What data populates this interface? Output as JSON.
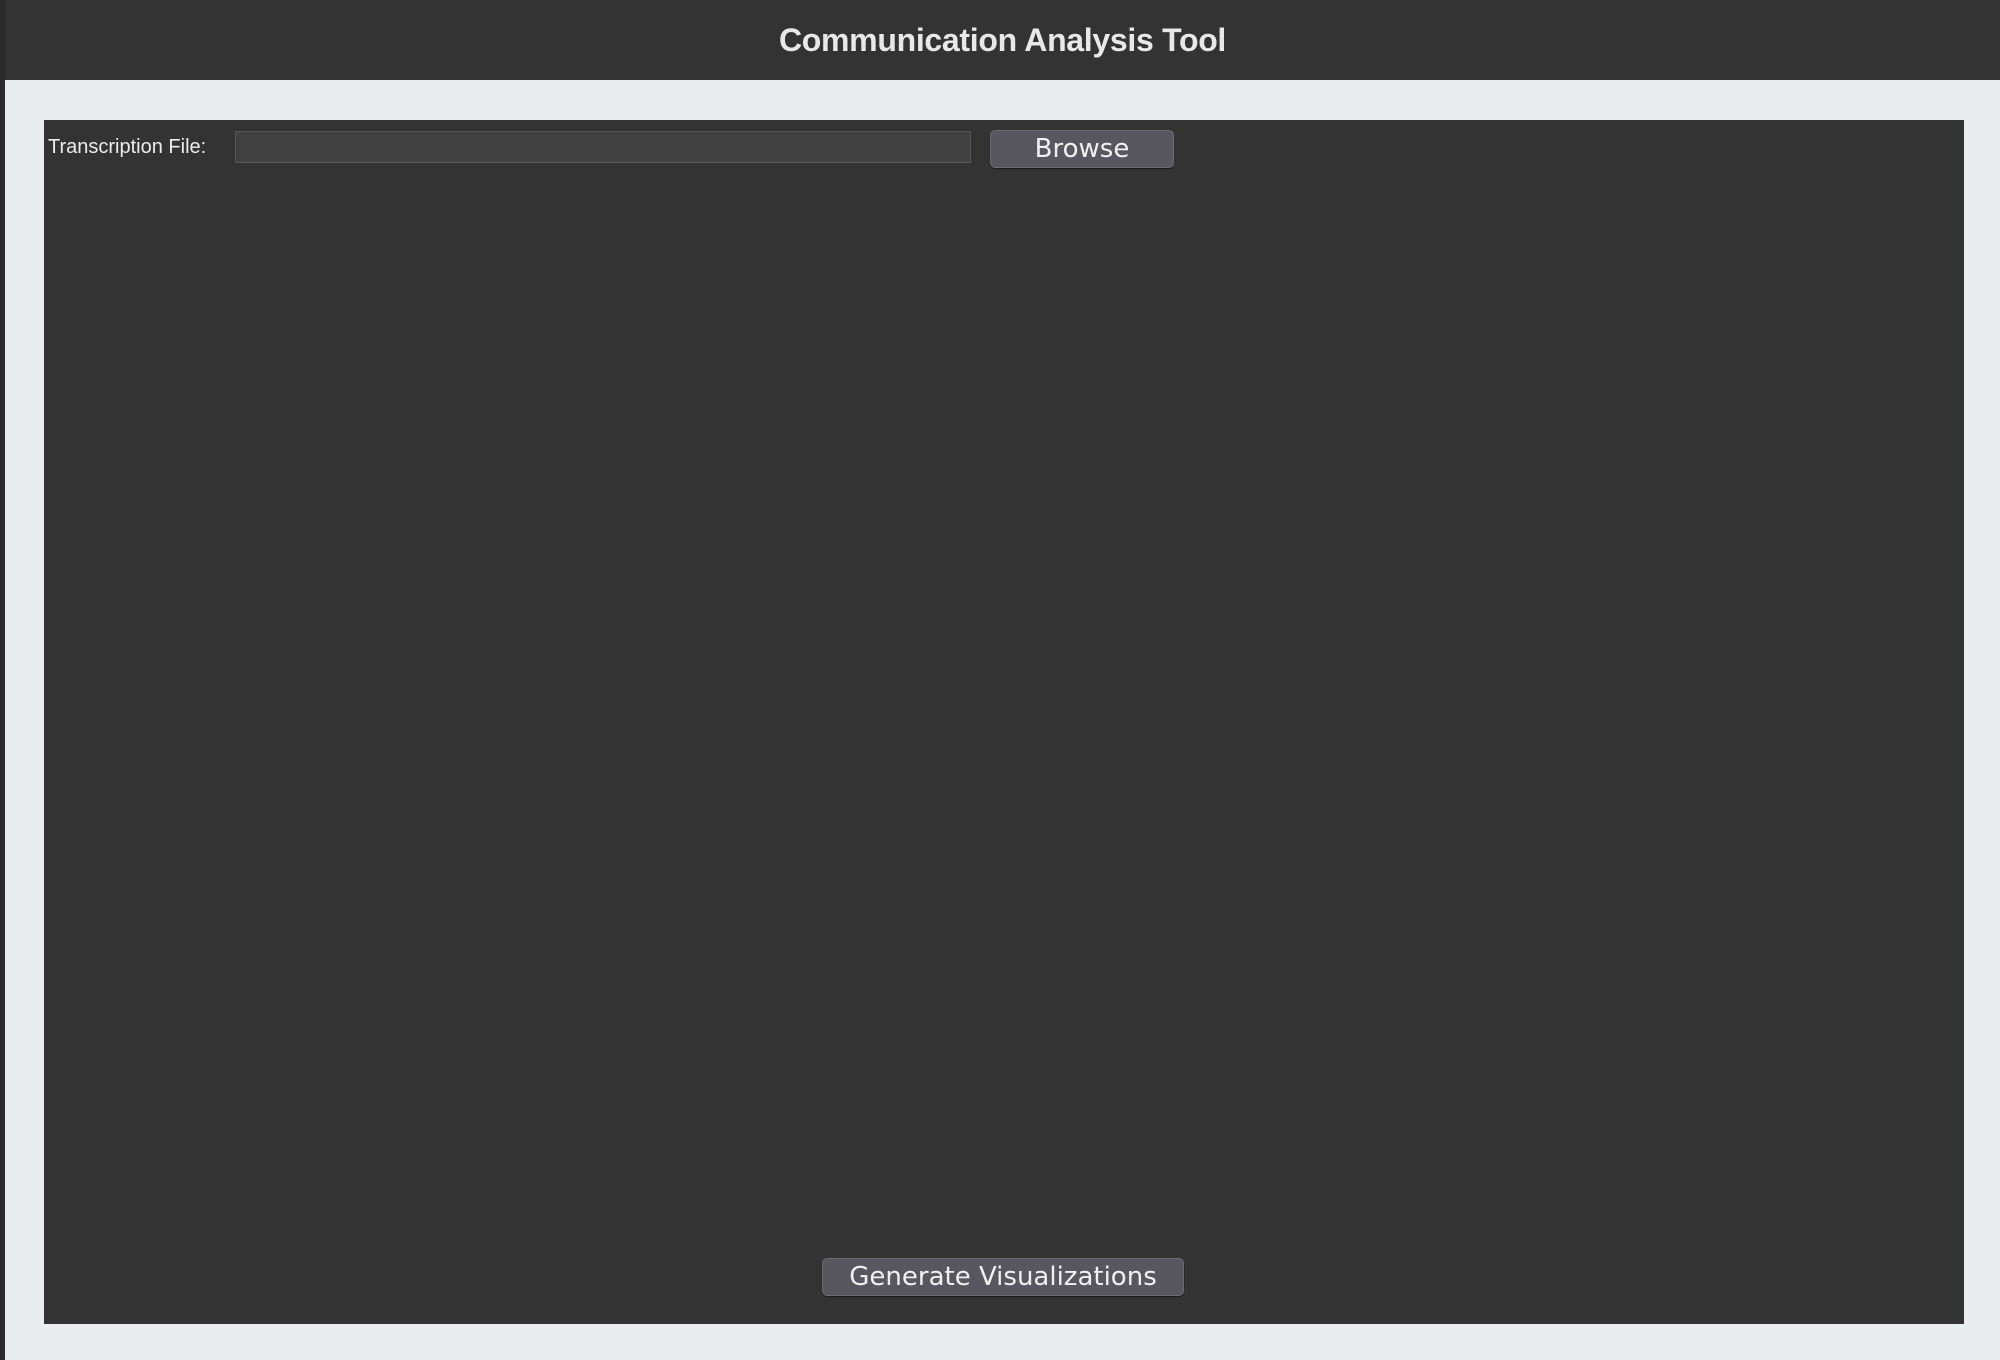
{
  "window": {
    "title": "Communication Analysis Tool"
  },
  "form": {
    "file_label": "Transcription File:",
    "file_value": "",
    "browse_label": "Browse",
    "generate_label": "Generate Visualizations"
  },
  "colors": {
    "titlebar_bg": "#333333",
    "panel_bg": "#333333",
    "window_bg": "#eaeded",
    "button_bg": "#58565e"
  }
}
